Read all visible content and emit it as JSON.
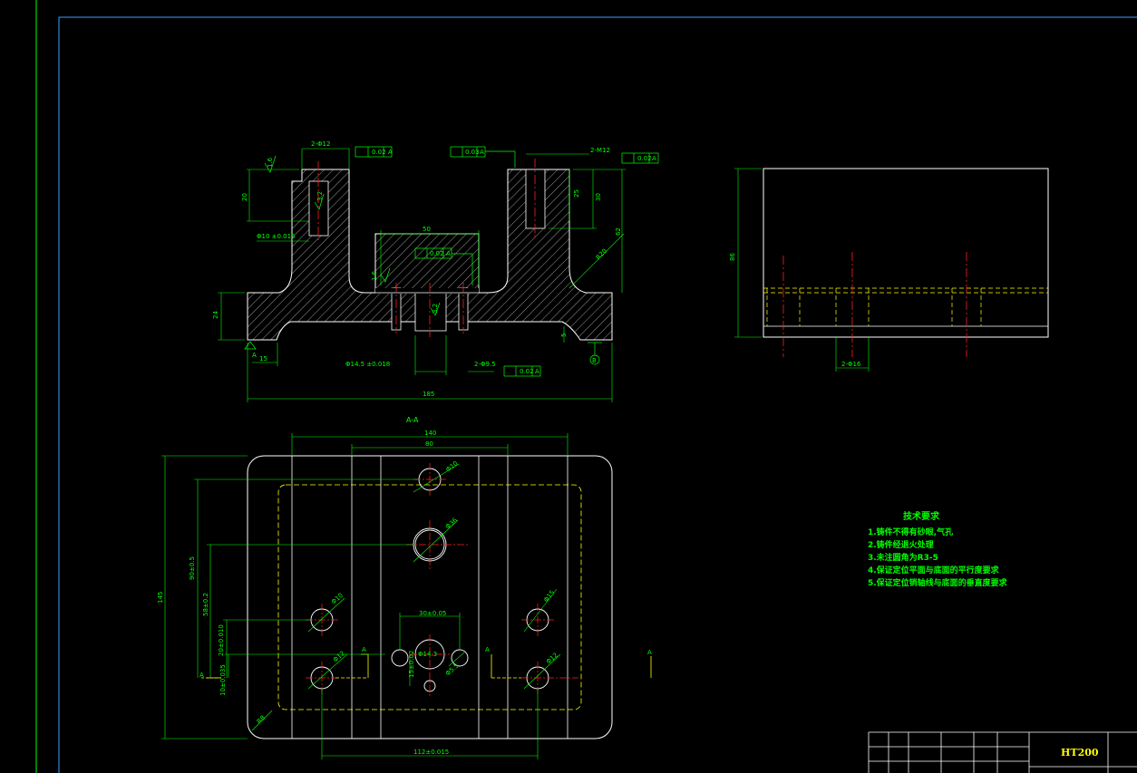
{
  "section_label": "A-A",
  "material": "HT200",
  "technical_requirements": {
    "title": "技术要求",
    "items": [
      "1.铸件不得有砂眼,气孔",
      "2.铸件经退火处理",
      "3.未注圆角为R3-5",
      "4.保证定位平面与底面的平行度要求",
      "5.保证定位销轴线与底面的垂直度要求"
    ]
  },
  "front_view_dims": {
    "d_2_phi12_left": "2-Φ12",
    "d_2_m12_right": "2-M12",
    "d_20": "20",
    "d_25": "25",
    "d_30": "30",
    "d_62": "62",
    "d_50": "50",
    "d_24": "24",
    "d_15": "15",
    "d_185": "185",
    "d_5": "5",
    "d_phi10": "Φ10 ±0.015",
    "d_phi14_5": "Φ14.5 ±0.018",
    "d_2_phi9_5": "2-Φ9.5",
    "d_r20": "R20",
    "tol_perp_left": "0.02",
    "tol_par_top": "0.03",
    "tol_perp_right": "0.02",
    "tol_par_mid": "0.02",
    "tol_perp_bottom": "0.02",
    "datum_a": "A",
    "datum_b": "B",
    "rough_left": "1.6",
    "rough_mid": "1.6",
    "rough_bore": "3.2",
    "rough_hole": "3.2"
  },
  "side_view_dims": {
    "d_86": "86",
    "d_2_phi16": "2-Φ16"
  },
  "plan_view_dims": {
    "d_140": "140",
    "d_80": "80",
    "d_145": "145",
    "d_90": "90±0.5",
    "d_58": "58±0.2",
    "d_20": "20±0.010",
    "d_10": "10±0.035",
    "d_112": "112±0.015",
    "d_30": "30±0.05",
    "d_15": "15±0.02",
    "d_r8": "R8",
    "d_phi10_top": "Φ10",
    "d_phi36": "Φ36",
    "d_phi10_left": "Φ10",
    "d_phi12_left": "Φ12",
    "d_phi15_right": "Φ15",
    "d_phi12_right": "Φ12",
    "d_phi14_3": "Φ14.3",
    "d_phi5_5": "Φ5.5",
    "cut_a": "A"
  }
}
